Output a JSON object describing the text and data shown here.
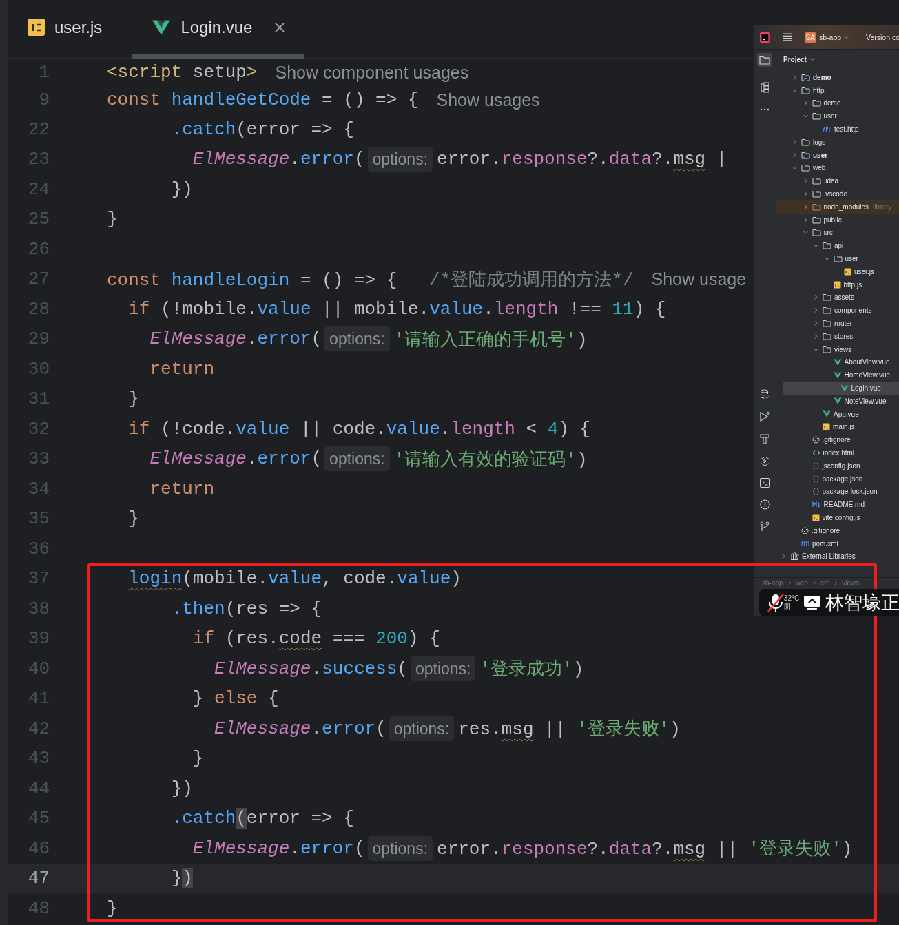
{
  "tabs": [
    {
      "label": "user.js",
      "kind": "js",
      "selected": false,
      "closable": false
    },
    {
      "label": "Login.vue",
      "kind": "vue",
      "selected": true,
      "closable": true
    }
  ],
  "sticky_lines": [
    {
      "number": "1",
      "current": false,
      "tokens": [
        {
          "kind": "tag",
          "text": "<script"
        },
        {
          "kind": "plain",
          "text": " setup"
        },
        {
          "kind": "tag",
          "text": ">"
        },
        {
          "kind": "usage",
          "text": "Show component usages"
        }
      ]
    },
    {
      "number": "9",
      "current": false,
      "tokens": [
        {
          "kind": "keyword",
          "text": "const "
        },
        {
          "kind": "function",
          "text": "handleGetCode"
        },
        {
          "kind": "plain",
          "text": " = () => {"
        },
        {
          "kind": "usage",
          "text": "Show usages"
        }
      ]
    }
  ],
  "lines": [
    {
      "number": "22",
      "current": false,
      "tokens": [
        {
          "kind": "method",
          "text": "      .catch"
        },
        {
          "kind": "plain",
          "text": "(error => {"
        }
      ]
    },
    {
      "number": "23",
      "current": false,
      "tokens": [
        {
          "kind": "class",
          "text": "        ElMessage"
        },
        {
          "kind": "plain",
          "text": "."
        },
        {
          "kind": "method",
          "text": "error"
        },
        {
          "kind": "plain",
          "text": "("
        },
        {
          "kind": "hint",
          "text": "options:"
        },
        {
          "kind": "plain",
          "text": "error."
        },
        {
          "kind": "property",
          "text": "response"
        },
        {
          "kind": "plain",
          "text": "?."
        },
        {
          "kind": "property",
          "text": "data"
        },
        {
          "kind": "plain",
          "text": "?."
        },
        {
          "kind": "wavy",
          "text": "msg"
        },
        {
          "kind": "plain",
          "text": " |"
        }
      ]
    },
    {
      "number": "24",
      "current": false,
      "tokens": [
        {
          "kind": "plain",
          "text": "      })"
        }
      ]
    },
    {
      "number": "25",
      "current": false,
      "tokens": [
        {
          "kind": "plain",
          "text": "}"
        }
      ]
    },
    {
      "number": "26",
      "current": false
    },
    {
      "number": "27",
      "current": false,
      "tokens": [
        {
          "kind": "keyword",
          "text": "const "
        },
        {
          "kind": "function",
          "text": "handleLogin"
        },
        {
          "kind": "plain",
          "text": " = () => {   "
        },
        {
          "kind": "comment",
          "text": "/*登陆成功调用的方法*/"
        },
        {
          "kind": "usage",
          "text": "Show usage"
        }
      ]
    },
    {
      "number": "28",
      "current": false,
      "tokens": [
        {
          "kind": "keyword",
          "text": "  if"
        },
        {
          "kind": "plain",
          "text": " (!mobile."
        },
        {
          "kind": "value",
          "text": "value"
        },
        {
          "kind": "plain",
          "text": " || mobile."
        },
        {
          "kind": "value",
          "text": "value"
        },
        {
          "kind": "plain",
          "text": "."
        },
        {
          "kind": "property",
          "text": "length"
        },
        {
          "kind": "plain",
          "text": " !== "
        },
        {
          "kind": "number",
          "text": "11"
        },
        {
          "kind": "plain",
          "text": ") {"
        }
      ]
    },
    {
      "number": "29",
      "current": false,
      "tokens": [
        {
          "kind": "class",
          "text": "    ElMessage"
        },
        {
          "kind": "plain",
          "text": "."
        },
        {
          "kind": "method",
          "text": "error"
        },
        {
          "kind": "plain",
          "text": "("
        },
        {
          "kind": "hint",
          "text": "options:"
        },
        {
          "kind": "string",
          "text": "'请输入正确的手机号'"
        },
        {
          "kind": "plain",
          "text": ")"
        }
      ]
    },
    {
      "number": "30",
      "current": false,
      "tokens": [
        {
          "kind": "keyword",
          "text": "    return"
        }
      ]
    },
    {
      "number": "31",
      "current": false,
      "tokens": [
        {
          "kind": "plain",
          "text": "  }"
        }
      ]
    },
    {
      "number": "32",
      "current": false,
      "tokens": [
        {
          "kind": "keyword",
          "text": "  if"
        },
        {
          "kind": "plain",
          "text": " (!code."
        },
        {
          "kind": "value",
          "text": "value"
        },
        {
          "kind": "plain",
          "text": " || code."
        },
        {
          "kind": "value",
          "text": "value"
        },
        {
          "kind": "plain",
          "text": "."
        },
        {
          "kind": "property",
          "text": "length"
        },
        {
          "kind": "plain",
          "text": " < "
        },
        {
          "kind": "number",
          "text": "4"
        },
        {
          "kind": "plain",
          "text": ") {"
        }
      ]
    },
    {
      "number": "33",
      "current": false,
      "tokens": [
        {
          "kind": "class",
          "text": "    ElMessage"
        },
        {
          "kind": "plain",
          "text": "."
        },
        {
          "kind": "method",
          "text": "error"
        },
        {
          "kind": "plain",
          "text": "("
        },
        {
          "kind": "hint",
          "text": "options:"
        },
        {
          "kind": "string",
          "text": "'请输入有效的验证码'"
        },
        {
          "kind": "plain",
          "text": ")"
        }
      ]
    },
    {
      "number": "34",
      "current": false,
      "tokens": [
        {
          "kind": "keyword",
          "text": "    return"
        }
      ]
    },
    {
      "number": "35",
      "current": false,
      "tokens": [
        {
          "kind": "plain",
          "text": "  }"
        }
      ]
    },
    {
      "number": "36",
      "current": false
    },
    {
      "number": "37",
      "current": false,
      "tokens": [
        {
          "kind": "wavy-function",
          "text": "  login"
        },
        {
          "kind": "plain",
          "text": "(mobile."
        },
        {
          "kind": "value",
          "text": "value"
        },
        {
          "kind": "plain",
          "text": ", code."
        },
        {
          "kind": "value",
          "text": "value"
        },
        {
          "kind": "plain",
          "text": ")"
        }
      ]
    },
    {
      "number": "38",
      "current": false,
      "tokens": [
        {
          "kind": "method",
          "text": "      .then"
        },
        {
          "kind": "plain",
          "text": "(res => {"
        }
      ]
    },
    {
      "number": "39",
      "current": false,
      "tokens": [
        {
          "kind": "keyword",
          "text": "        if"
        },
        {
          "kind": "plain",
          "text": " (res."
        },
        {
          "kind": "wavy",
          "text": "code"
        },
        {
          "kind": "plain",
          "text": " === "
        },
        {
          "kind": "number",
          "text": "200"
        },
        {
          "kind": "plain",
          "text": ") {"
        }
      ]
    },
    {
      "number": "40",
      "current": false,
      "tokens": [
        {
          "kind": "class",
          "text": "          ElMessage"
        },
        {
          "kind": "plain",
          "text": "."
        },
        {
          "kind": "method",
          "text": "success"
        },
        {
          "kind": "plain",
          "text": "("
        },
        {
          "kind": "hint",
          "text": "options:"
        },
        {
          "kind": "string",
          "text": "'登录成功'"
        },
        {
          "kind": "plain",
          "text": ")"
        }
      ]
    },
    {
      "number": "41",
      "current": false,
      "tokens": [
        {
          "kind": "plain",
          "text": "        } "
        },
        {
          "kind": "keyword",
          "text": "else"
        },
        {
          "kind": "plain",
          "text": " {"
        }
      ]
    },
    {
      "number": "42",
      "current": false,
      "tokens": [
        {
          "kind": "class",
          "text": "          ElMessage"
        },
        {
          "kind": "plain",
          "text": "."
        },
        {
          "kind": "method",
          "text": "error"
        },
        {
          "kind": "plain",
          "text": "("
        },
        {
          "kind": "hint",
          "text": "options:"
        },
        {
          "kind": "plain",
          "text": "res."
        },
        {
          "kind": "wavy",
          "text": "msg"
        },
        {
          "kind": "plain",
          "text": " || "
        },
        {
          "kind": "string",
          "text": "'登录失败'"
        },
        {
          "kind": "plain",
          "text": ")"
        }
      ]
    },
    {
      "number": "43",
      "current": false,
      "tokens": [
        {
          "kind": "plain",
          "text": "        }"
        }
      ]
    },
    {
      "number": "44",
      "current": false,
      "tokens": [
        {
          "kind": "plain",
          "text": "      })"
        }
      ]
    },
    {
      "number": "45",
      "current": false,
      "tokens": [
        {
          "kind": "method",
          "text": "      .catch"
        },
        {
          "kind": "bracket",
          "text": "("
        },
        {
          "kind": "plain",
          "text": "error => {"
        }
      ]
    },
    {
      "number": "46",
      "current": false,
      "tokens": [
        {
          "kind": "class",
          "text": "        ElMessage"
        },
        {
          "kind": "plain",
          "text": "."
        },
        {
          "kind": "method",
          "text": "error"
        },
        {
          "kind": "plain",
          "text": "("
        },
        {
          "kind": "hint",
          "text": "options:"
        },
        {
          "kind": "plain",
          "text": "error."
        },
        {
          "kind": "property",
          "text": "response"
        },
        {
          "kind": "plain",
          "text": "?."
        },
        {
          "kind": "property",
          "text": "data"
        },
        {
          "kind": "plain",
          "text": "?."
        },
        {
          "kind": "wavy",
          "text": "msg"
        },
        {
          "kind": "plain",
          "text": " || "
        },
        {
          "kind": "string",
          "text": "'登录失败'"
        },
        {
          "kind": "plain",
          "text": ")"
        }
      ]
    },
    {
      "number": "47",
      "current": true,
      "tokens": [
        {
          "kind": "plain",
          "text": "      }"
        },
        {
          "kind": "bracket",
          "text": ")"
        }
      ]
    },
    {
      "number": "48",
      "current": false,
      "tokens": [
        {
          "kind": "plain",
          "text": "}"
        }
      ]
    }
  ],
  "project_panel": {
    "project_badge": "SA",
    "project_name": "sb-app",
    "menu_cut": "Version co",
    "title": "Project",
    "tree": [
      {
        "label": "demo",
        "kind": "module",
        "expanded": false,
        "selected": false
      },
      {
        "label": "http",
        "kind": "folder",
        "expanded": true,
        "selected": false,
        "children": [
          {
            "label": "demo",
            "kind": "folder",
            "expanded": false,
            "selected": false
          },
          {
            "label": "user",
            "kind": "folder",
            "expanded": true,
            "selected": false,
            "children": [
              {
                "label": "test.http",
                "kind": "http",
                "selected": false
              }
            ]
          }
        ]
      },
      {
        "label": "logs",
        "kind": "folder",
        "expanded": false,
        "selected": false
      },
      {
        "label": "user",
        "kind": "module",
        "expanded": false,
        "selected": false
      },
      {
        "label": "web",
        "kind": "folder",
        "expanded": true,
        "selected": false,
        "children": [
          {
            "label": ".idea",
            "kind": "folder",
            "expanded": false,
            "selected": false
          },
          {
            "label": ".vscode",
            "kind": "folder",
            "expanded": false,
            "selected": false
          },
          {
            "label": "node_modules",
            "kind": "library",
            "note": "library",
            "expanded": false,
            "selected": false
          },
          {
            "label": "public",
            "kind": "folder",
            "expanded": false,
            "selected": false
          },
          {
            "label": "src",
            "kind": "folder",
            "expanded": true,
            "selected": false,
            "children": [
              {
                "label": "api",
                "kind": "folder",
                "expanded": true,
                "selected": false,
                "children": [
                  {
                    "label": "user",
                    "kind": "folder",
                    "expanded": true,
                    "selected": false,
                    "children": [
                      {
                        "label": "user.js",
                        "kind": "js",
                        "selected": false
                      }
                    ]
                  },
                  {
                    "label": "http.js",
                    "kind": "js",
                    "selected": false
                  }
                ]
              },
              {
                "label": "assets",
                "kind": "folder",
                "expanded": false,
                "selected": false
              },
              {
                "label": "components",
                "kind": "folder",
                "expanded": false,
                "selected": false
              },
              {
                "label": "router",
                "kind": "folder",
                "expanded": false,
                "selected": false
              },
              {
                "label": "stores",
                "kind": "folder",
                "expanded": false,
                "selected": false
              },
              {
                "label": "views",
                "kind": "folder",
                "expanded": true,
                "selected": false,
                "children": [
                  {
                    "label": "AboutView.vue",
                    "kind": "vue",
                    "selected": false
                  },
                  {
                    "label": "HomeView.vue",
                    "kind": "vue",
                    "selected": false
                  },
                  {
                    "label": "Login.vue",
                    "kind": "vue",
                    "selected": true
                  },
                  {
                    "label": "NoteView.vue",
                    "kind": "vue",
                    "selected": false
                  }
                ]
              },
              {
                "label": "App.vue",
                "kind": "vue",
                "selected": false
              },
              {
                "label": "main.js",
                "kind": "js",
                "selected": false
              }
            ]
          },
          {
            "label": ".gitignore",
            "kind": "ignore",
            "selected": false
          },
          {
            "label": "index.html",
            "kind": "html",
            "selected": false
          },
          {
            "label": "jsconfig.json",
            "kind": "json",
            "selected": false
          },
          {
            "label": "package.json",
            "kind": "json",
            "selected": false
          },
          {
            "label": "package-lock.json",
            "kind": "json",
            "selected": false
          },
          {
            "label": "README.md",
            "kind": "md",
            "selected": false
          },
          {
            "label": "vite.config.js",
            "kind": "js",
            "selected": false
          }
        ]
      },
      {
        "label": ".gitignore",
        "kind": "ignore",
        "selected": false
      },
      {
        "label": "pom.xml",
        "kind": "xml",
        "selected": false
      }
    ],
    "external_libraries": "External Libraries",
    "breadcrumb": [
      "sb-app",
      "web",
      "src",
      "views"
    ]
  },
  "screen_share_bar": {
    "temperature": "32°C",
    "weather": "阴",
    "presenter": "林智壕正"
  }
}
